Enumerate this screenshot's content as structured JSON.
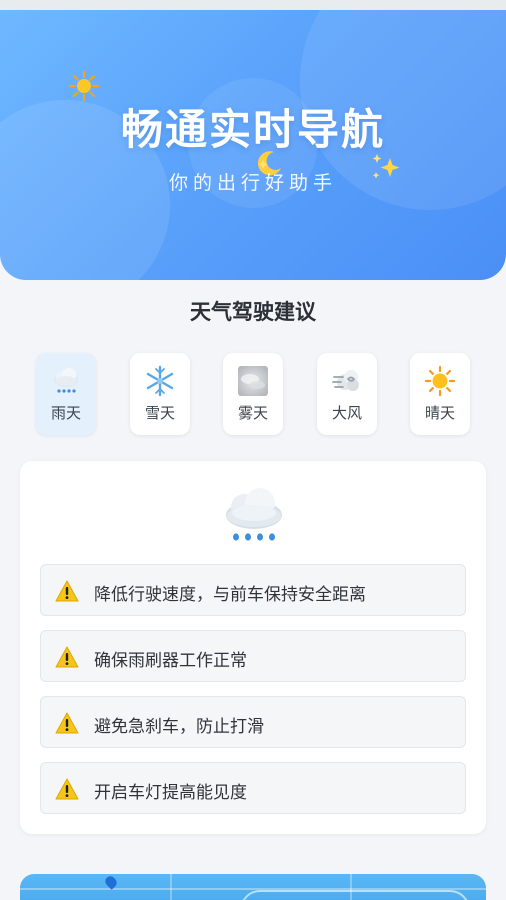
{
  "hero": {
    "title": "畅通实时导航",
    "subtitle": "你的出行好助手"
  },
  "section": {
    "title": "天气驾驶建议"
  },
  "weather_tabs": [
    {
      "label": "雨天",
      "icon": "rain-cloud-icon",
      "selected": true
    },
    {
      "label": "雪天",
      "icon": "snowflake-icon",
      "selected": false
    },
    {
      "label": "雾天",
      "icon": "fog-icon",
      "selected": false
    },
    {
      "label": "大风",
      "icon": "wind-icon",
      "selected": false
    },
    {
      "label": "晴天",
      "icon": "sun-icon",
      "selected": false
    }
  ],
  "advice": {
    "icon": "rain-cloud-icon",
    "tips": [
      "降低行驶速度，与前车保持安全距离",
      "确保雨刷器工作正常",
      "避免急刹车，防止打滑",
      "开启车灯提高能见度"
    ]
  },
  "colors": {
    "hero_gradient_start": "#6fb8ff",
    "hero_gradient_end": "#4b8ff6",
    "selected_tab_bg": "#e4f0fc",
    "warning_yellow": "#f5c518",
    "page_bg": "#f3f5f8"
  }
}
